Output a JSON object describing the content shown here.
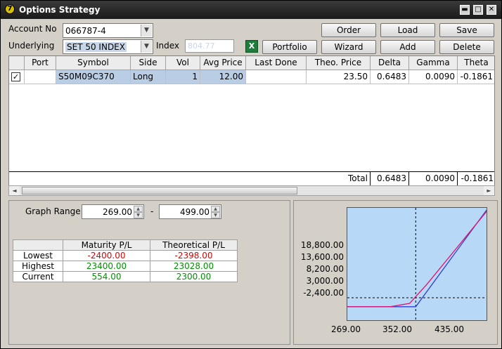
{
  "window": {
    "title": "Options Strategy",
    "title_icon_text": "7",
    "min_glyph": "▬",
    "max_glyph": "□",
    "close_glyph": "✕"
  },
  "form": {
    "account_label": "Account No",
    "account_value": "066787-4",
    "underlying_label": "Underlying",
    "underlying_value": "SET 50 INDEX",
    "index_label": "Index",
    "index_value": "804.77",
    "excel_icon_text": "X"
  },
  "buttons": {
    "order": "Order",
    "load": "Load",
    "save": "Save",
    "portfolio": "Portfolio",
    "wizard": "Wizard",
    "add": "Add",
    "delete": "Delete"
  },
  "grid": {
    "columns": [
      "Port",
      "Symbol",
      "Side",
      "Vol",
      "Avg Price",
      "Last Done",
      "Theo. Price",
      "Delta",
      "Gamma",
      "Theta"
    ],
    "rows": [
      {
        "checked": true,
        "check_glyph": "✓",
        "port": "",
        "symbol": "S50M09C370",
        "side": "Long",
        "vol": "1",
        "avg_price": "12.00",
        "last_done": "",
        "theo_price": "23.50",
        "delta": "0.6483",
        "gamma": "0.0090",
        "theta": "-0.1861"
      }
    ],
    "total": {
      "label": "Total",
      "delta": "0.6483",
      "gamma": "0.0090",
      "theta": "-0.1861"
    },
    "scroll_left": "◄",
    "scroll_right": "►",
    "scroll_position": 0
  },
  "graph_range": {
    "label": "Graph Range",
    "from": "269.00",
    "to": "499.00",
    "separator": "-",
    "up_glyph": "▲",
    "down_glyph": "▼"
  },
  "pl_table": {
    "headers": [
      "Maturity P/L",
      "Theoretical P/L"
    ],
    "rows": [
      {
        "label": "Lowest",
        "maturity": "-2400.00",
        "theoretical": "-2398.00",
        "color": "red"
      },
      {
        "label": "Highest",
        "maturity": "23400.00",
        "theoretical": "23028.00",
        "color": "green"
      },
      {
        "label": "Current",
        "maturity": "554.00",
        "theoretical": "2300.00",
        "color": "green"
      }
    ]
  },
  "chart_data": {
    "type": "line",
    "y_ticks": [
      "18,800.00",
      "13,600.00",
      "8,200.00",
      "3,000.00",
      "-2,400.00"
    ],
    "x_ticks": [
      "269.00",
      "352.00",
      "435.00"
    ],
    "xlim": [
      269,
      499
    ],
    "ylim": [
      -6000,
      24000
    ],
    "current_x": 382,
    "series": [
      {
        "color": "#3040d0",
        "points": [
          [
            269,
            -2400
          ],
          [
            382,
            -2400
          ],
          [
            499,
            23400
          ]
        ]
      },
      {
        "color": "#e0106a",
        "points": [
          [
            269,
            -2398
          ],
          [
            340,
            -2398
          ],
          [
            372,
            -1500
          ],
          [
            382,
            300
          ],
          [
            400,
            3500
          ],
          [
            499,
            23028
          ]
        ]
      }
    ],
    "zero_line": 0,
    "colors": {
      "background": "#b7d9f7",
      "crosshair": "#000000"
    }
  }
}
